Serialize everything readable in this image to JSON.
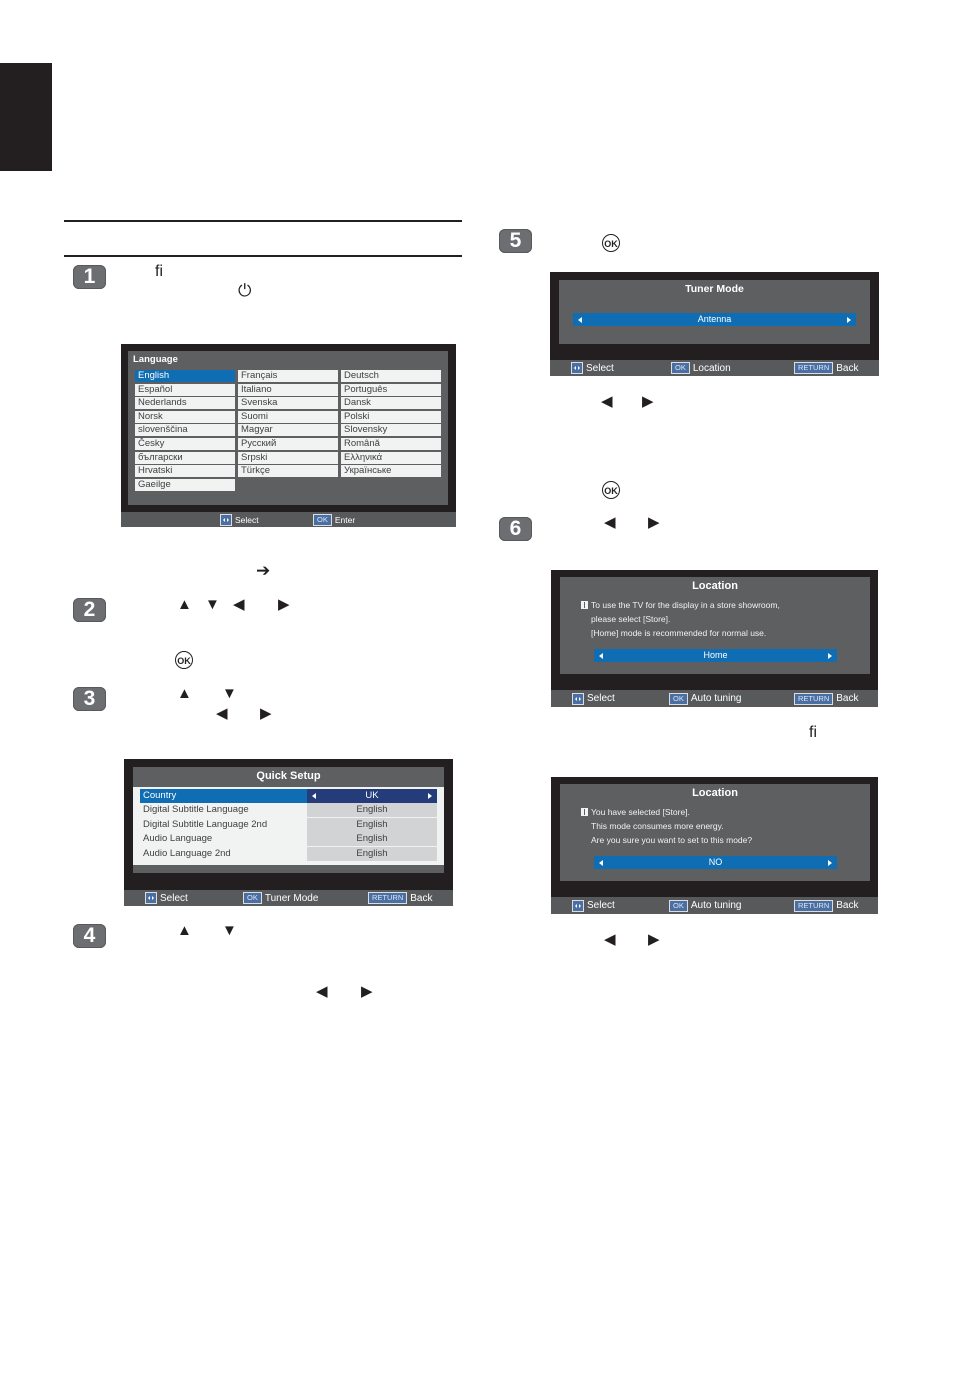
{
  "page": {
    "side_tab_color": "#231f20",
    "step_badges": [
      "1",
      "2",
      "3",
      "4",
      "5",
      "6"
    ],
    "step1": {
      "ligature": "ﬁ",
      "power_symbol": "⏻"
    },
    "after_lang": {
      "arrow": "➔"
    },
    "step2": {
      "arrows": [
        "▲",
        "▼",
        "◀",
        "▶"
      ],
      "ok": "OK"
    },
    "step3": {
      "up_down": [
        "▲",
        "▼"
      ],
      "left_right": [
        "◀",
        "▶"
      ]
    },
    "step4": {
      "up_down": [
        "▲",
        "▼"
      ],
      "left_right": [
        "◀",
        "▶"
      ]
    },
    "step5": {
      "ok": "OK",
      "left_right": [
        "◀",
        "▶"
      ],
      "ok2": "OK"
    },
    "step6": {
      "left_right": [
        "◀",
        "▶"
      ],
      "ligature": "ﬁ",
      "left_right_2": [
        "◀",
        "▶"
      ]
    }
  },
  "colors": {
    "highlight_blue": "#0f6db3",
    "value_dark_blue": "#243c79",
    "screen_black": "#231f20",
    "panel_gray": "#5e5f61",
    "footer_gray": "#58595b"
  },
  "language_screen": {
    "title": "Language",
    "selected": "English",
    "columns": [
      [
        "English",
        "Español",
        "Nederlands",
        "Norsk",
        "slovenščina",
        "Česky",
        "български",
        "Hrvatski",
        "Gaeilge"
      ],
      [
        "Français",
        "Italiano",
        "Svenska",
        "Suomi",
        "Magyar",
        "Русский",
        "Srpski",
        "Türkçe"
      ],
      [
        "Deutsch",
        "Português",
        "Dansk",
        "Polski",
        "Slovensky",
        "Română",
        "Ελληνικά",
        "Українське"
      ]
    ],
    "footer": {
      "select": "Select",
      "ok_key": "OK",
      "enter": "Enter"
    }
  },
  "quick_setup_screen": {
    "title": "Quick Setup",
    "rows": [
      {
        "label": "Country",
        "value": "UK",
        "selected": true
      },
      {
        "label": "Digital Subtitle Language",
        "value": "English"
      },
      {
        "label": "Digital Subtitle Language 2nd",
        "value": "English"
      },
      {
        "label": "Audio Language",
        "value": "English"
      },
      {
        "label": "Audio Language 2nd",
        "value": "English"
      }
    ],
    "footer": {
      "select": "Select",
      "ok_key": "OK",
      "ok_action": "Tuner Mode",
      "return_key": "RETURN",
      "back": "Back"
    }
  },
  "tuner_mode_screen": {
    "title": "Tuner Mode",
    "value": "Antenna",
    "footer": {
      "select": "Select",
      "ok_key": "OK",
      "ok_action": "Location",
      "return_key": "RETURN",
      "back": "Back"
    }
  },
  "location_screen_1": {
    "title": "Location",
    "lines": [
      "To use the TV for the display in a store showroom,",
      "please select [Store].",
      "[Home] mode is recommended for normal use."
    ],
    "value": "Home",
    "footer": {
      "select": "Select",
      "ok_key": "OK",
      "ok_action": "Auto tuning",
      "return_key": "RETURN",
      "back": "Back"
    }
  },
  "location_screen_2": {
    "title": "Location",
    "lines": [
      "You have selected [Store].",
      "This mode consumes more energy.",
      "Are you sure you want to set to this mode?"
    ],
    "value": "NO",
    "footer": {
      "select": "Select",
      "ok_key": "OK",
      "ok_action": "Auto tuning",
      "return_key": "RETURN",
      "back": "Back"
    }
  }
}
